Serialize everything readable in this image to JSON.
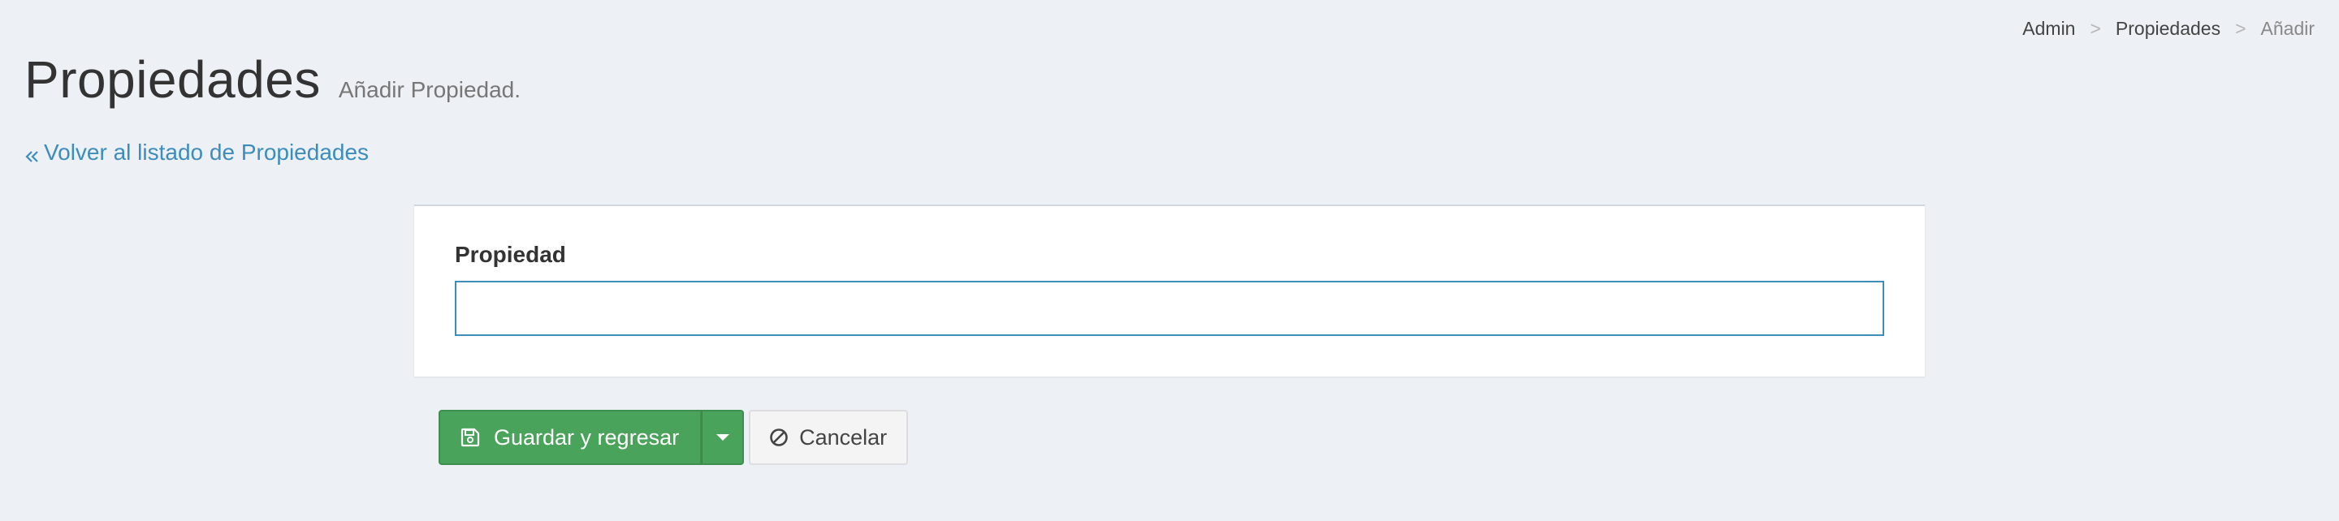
{
  "breadcrumb": {
    "items": [
      "Admin",
      "Propiedades",
      "Añadir"
    ],
    "separator": ">"
  },
  "header": {
    "title": "Propiedades",
    "subtitle": "Añadir Propiedad."
  },
  "back_link": {
    "label": "Volver al listado de Propiedades",
    "icon": "double-chevron-left-icon"
  },
  "form": {
    "field_label": "Propiedad",
    "field_value": "",
    "field_placeholder": ""
  },
  "actions": {
    "save_label": "Guardar y regresar",
    "save_icon": "floppy-disk-icon",
    "dropdown_icon": "caret-down-icon",
    "cancel_label": "Cancelar",
    "cancel_icon": "ban-icon"
  },
  "colors": {
    "background": "#edf0f4",
    "link": "#3c8dbc",
    "success": "#4aa35a",
    "input_focus_border": "#3c8dbc"
  }
}
